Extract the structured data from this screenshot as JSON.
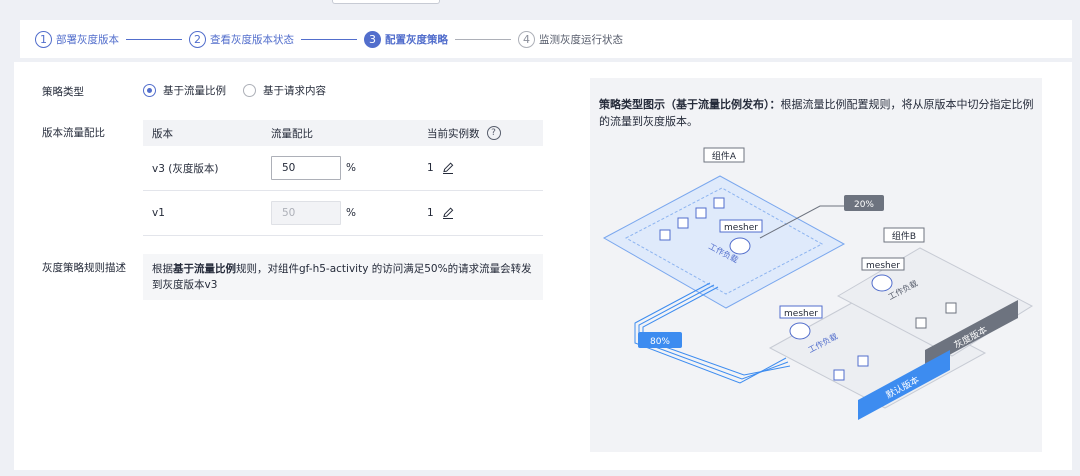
{
  "steps": [
    {
      "num": "1",
      "label": "部署灰度版本"
    },
    {
      "num": "2",
      "label": "查看灰度版本状态"
    },
    {
      "num": "3",
      "label": "配置灰度策略"
    },
    {
      "num": "4",
      "label": "监测灰度运行状态"
    }
  ],
  "form": {
    "strategy_type_label": "策略类型",
    "strategy_options": [
      "基于流量比例",
      "基于请求内容"
    ],
    "selected_strategy": "基于流量比例",
    "ratio_label": "版本流量配比",
    "desc_label": "灰度策略规则描述"
  },
  "table": {
    "headers": [
      "版本",
      "流量配比",
      "当前实例数"
    ],
    "help_icon": "question-icon",
    "rows": [
      {
        "version": "v3 (灰度版本)",
        "ratio": "50",
        "unit": "%",
        "instances": "1",
        "editable": true
      },
      {
        "version": "v1",
        "ratio": "50",
        "unit": "%",
        "instances": "1",
        "editable": false
      }
    ]
  },
  "description": {
    "prefix": "根据",
    "bold": "基于流量比例",
    "suffix": "规则，对组件gf-h5-activity 的访问满足50%的请求流量会转发到灰度版本v3"
  },
  "figure": {
    "title_bold": "策略类型图示（基于流量比例发布）：",
    "title_rest": "根据流量比例配置规则，将从原版本中切分指定比例的流量到灰度版本。",
    "component_a": "组件A",
    "component_b": "组件B",
    "mesher": "mesher",
    "workload": "工作负载",
    "pct_80": "80%",
    "pct_20": "20%",
    "default_version": "默认版本",
    "gray_version": "灰度版本"
  },
  "colors": {
    "primary": "#526ecc",
    "flow_blue": "#3d8cf0",
    "gray_tag": "#6d737f"
  }
}
